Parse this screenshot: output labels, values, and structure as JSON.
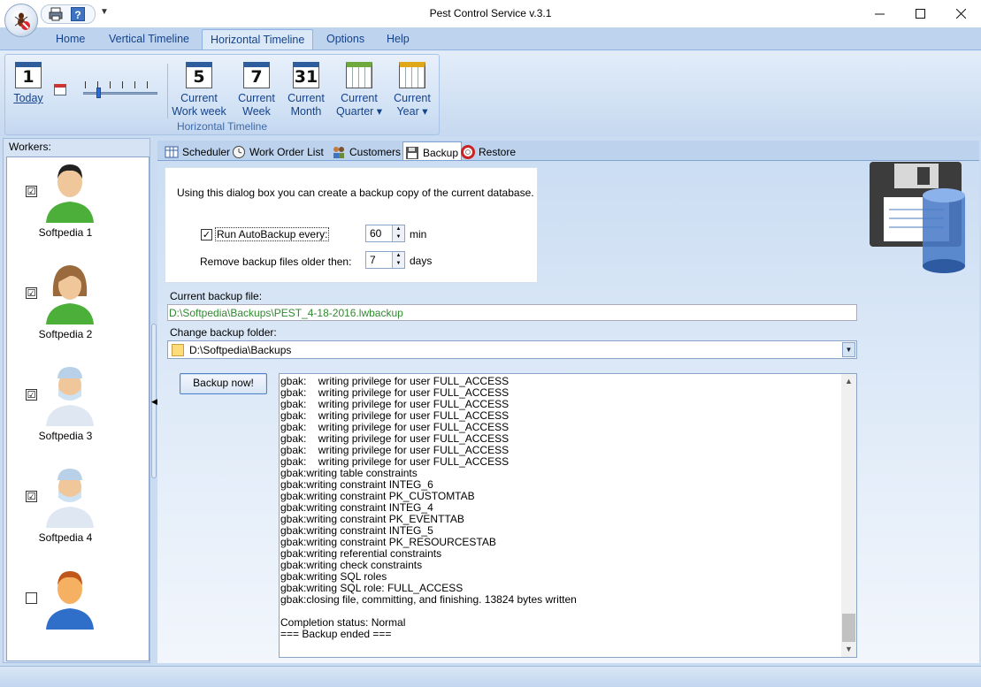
{
  "window": {
    "title": "Pest Control Service v.3.1"
  },
  "ribbon": {
    "tabs": [
      "Home",
      "Vertical Timeline",
      "Horizontal Timeline",
      "Options",
      "Help"
    ],
    "active_tab": "Horizontal Timeline",
    "group_label": "Horizontal Timeline",
    "today": {
      "icon_text": "1",
      "label": "Today"
    },
    "buttons": [
      {
        "icon_text": "5",
        "line1": "Current",
        "line2": "Work week"
      },
      {
        "icon_text": "7",
        "line1": "Current",
        "line2": "Week"
      },
      {
        "icon_text": "31",
        "line1": "Current",
        "line2": "Month"
      },
      {
        "icon_text": "",
        "line1": "Current",
        "line2": "Quarter ▾"
      },
      {
        "icon_text": "",
        "line1": "Current",
        "line2": "Year ▾"
      }
    ]
  },
  "workers": {
    "title": "Workers:",
    "items": [
      {
        "name": "Softpedia 1",
        "checked": "☑"
      },
      {
        "name": "Softpedia 2",
        "checked": "☑"
      },
      {
        "name": "Softpedia 3",
        "checked": "☑"
      },
      {
        "name": "Softpedia 4",
        "checked": "☑"
      },
      {
        "name": "",
        "checked": ""
      }
    ]
  },
  "doc_tabs": [
    "Scheduler",
    "Work Order List",
    "Customers",
    "Backup",
    "Restore"
  ],
  "active_doc_tab": "Backup",
  "backup": {
    "info": "Using this dialog box you can create a backup copy of the current database.",
    "autobackup_label": "Run AutoBackup every:",
    "autobackup_checked": "✓",
    "autobackup_value": "60",
    "autobackup_unit": "min",
    "remove_label": "Remove backup files older then:",
    "remove_value": "7",
    "remove_unit": "days",
    "current_file_label": "Current backup file:",
    "current_file": "D:\\Softpedia\\Backups\\PEST_4-18-2016.lwbackup",
    "change_folder_label": "Change backup folder:",
    "folder": "D:\\Softpedia\\Backups",
    "backup_now": "Backup now!",
    "log": [
      "gbak:    writing privilege for user FULL_ACCESS",
      "gbak:    writing privilege for user FULL_ACCESS",
      "gbak:    writing privilege for user FULL_ACCESS",
      "gbak:    writing privilege for user FULL_ACCESS",
      "gbak:    writing privilege for user FULL_ACCESS",
      "gbak:    writing privilege for user FULL_ACCESS",
      "gbak:    writing privilege for user FULL_ACCESS",
      "gbak:    writing privilege for user FULL_ACCESS",
      "gbak:writing table constraints",
      "gbak:writing constraint INTEG_6",
      "gbak:writing constraint PK_CUSTOMTAB",
      "gbak:writing constraint INTEG_4",
      "gbak:writing constraint PK_EVENTTAB",
      "gbak:writing constraint INTEG_5",
      "gbak:writing constraint PK_RESOURCESTAB",
      "gbak:writing referential constraints",
      "gbak:writing check constraints",
      "gbak:writing SQL roles",
      "gbak:writing SQL role: FULL_ACCESS",
      "gbak:closing file, committing, and finishing. 13824 bytes written",
      "",
      "Completion status: Normal",
      "=== Backup ended ==="
    ]
  }
}
